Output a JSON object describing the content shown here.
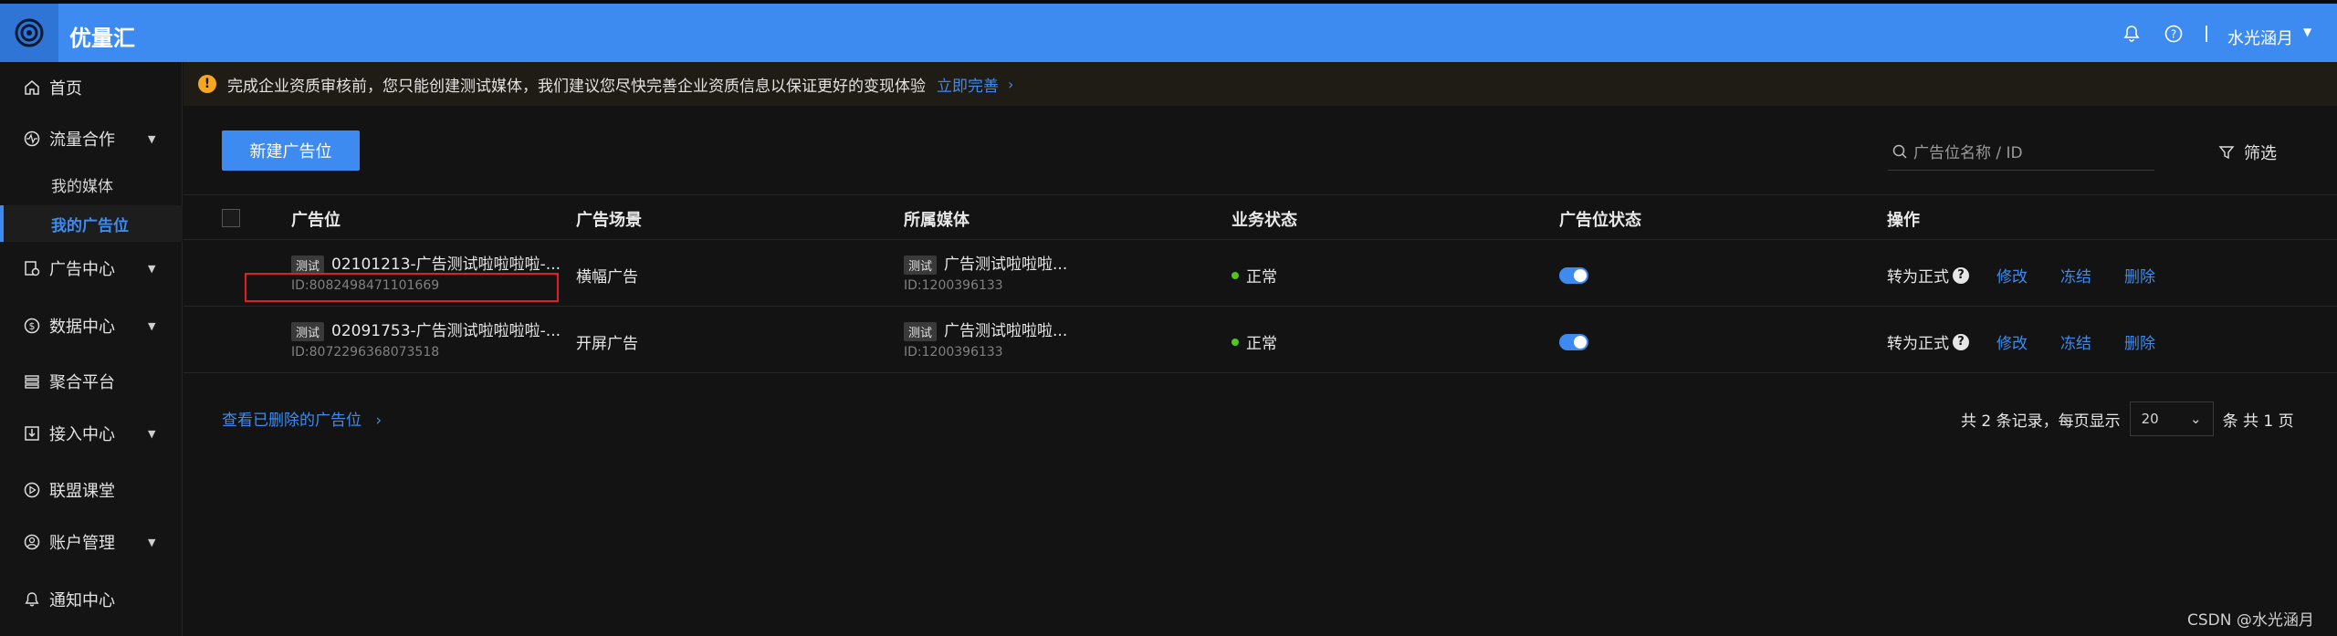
{
  "app": {
    "title": "优量汇"
  },
  "header": {
    "user_name": "水光涵月",
    "icons": [
      "bell-icon",
      "help-icon"
    ]
  },
  "sidebar": {
    "items": [
      {
        "label": "首页",
        "icon": "home-icon"
      },
      {
        "label": "流量合作",
        "icon": "traffic-icon"
      },
      {
        "label": "广告中心",
        "icon": "ad-center-icon"
      },
      {
        "label": "数据中心",
        "icon": "data-icon"
      },
      {
        "label": "聚合平台",
        "icon": "aggregate-icon"
      },
      {
        "label": "接入中心",
        "icon": "access-icon"
      },
      {
        "label": "联盟课堂",
        "icon": "play-icon"
      },
      {
        "label": "账户管理",
        "icon": "account-icon"
      },
      {
        "label": "通知中心",
        "icon": "bell-icon"
      }
    ],
    "sub_items": [
      {
        "label": "我的媒体"
      },
      {
        "label": "我的广告位",
        "active": true
      }
    ]
  },
  "notice": {
    "text": "完成企业资质审核前，您只能创建测试媒体，我们建议您尽快完善企业资质信息以保证更好的变现体验",
    "link": "立即完善"
  },
  "toolbar": {
    "new_button": "新建广告位",
    "search_placeholder": "广告位名称 / ID",
    "filter_label": "筛选"
  },
  "table": {
    "columns": [
      "广告位",
      "广告场景",
      "所属媒体",
      "业务状态",
      "广告位状态",
      "操作"
    ],
    "rows": [
      {
        "tag": "测试",
        "name": "02101213-广告测试啦啦啦啦-...",
        "id": "ID:8082498471101669",
        "scene": "横幅广告",
        "media_tag": "测试",
        "media": "广告测试啦啦啦...",
        "media_id": "ID:1200396133",
        "status": "正常",
        "enabled": true
      },
      {
        "tag": "测试",
        "name": "02091753-广告测试啦啦啦啦-...",
        "id": "ID:8072296368073518",
        "scene": "开屏广告",
        "media_tag": "测试",
        "media": "广告测试啦啦啦...",
        "media_id": "ID:1200396133",
        "status": "正常",
        "enabled": true
      }
    ],
    "ops": {
      "convert": "转为正式",
      "edit": "修改",
      "freeze": "冻结",
      "delete": "删除"
    }
  },
  "footer": {
    "deleted_link": "查看已删除的广告位",
    "total_prefix": "共 2 条记录，每页显示",
    "page_size": "20",
    "page_suffix": "条 共 1 页"
  },
  "watermark": "CSDN @水光涵月",
  "colors": {
    "primary": "#3d8bf0",
    "background": "#131313",
    "success": "#52c41a",
    "warning": "#f5a623",
    "highlight": "#e02020"
  }
}
